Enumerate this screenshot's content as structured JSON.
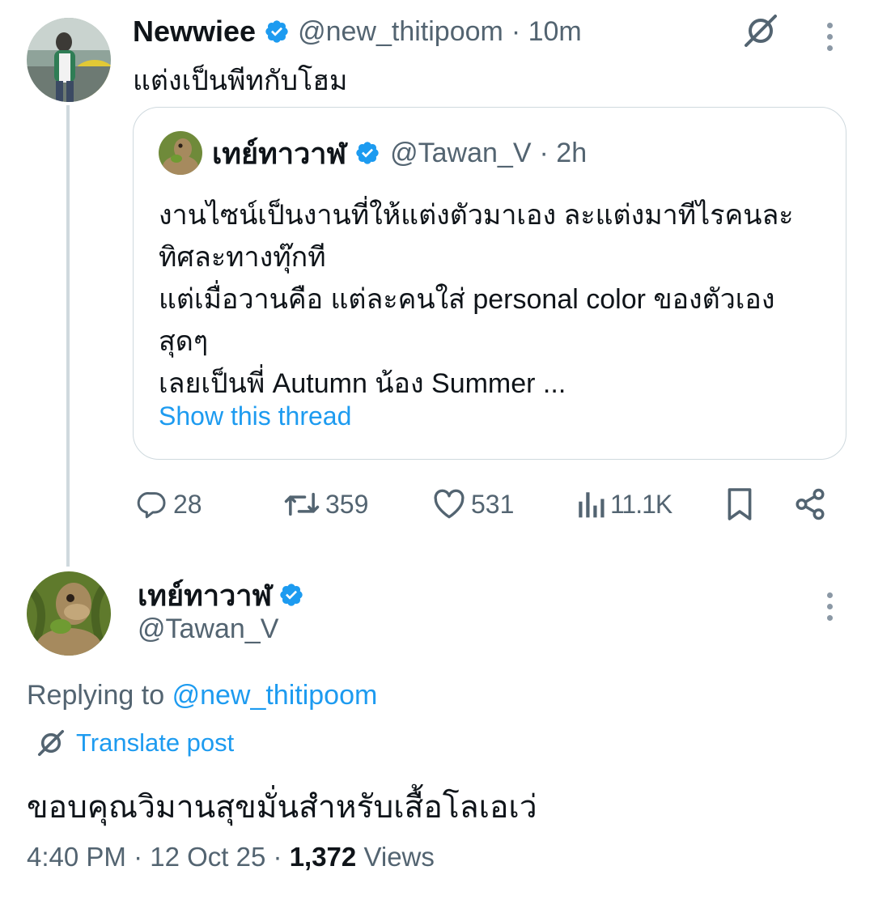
{
  "top_post": {
    "author_name": "Newwiee",
    "handle": "@new_thitipoom",
    "time": "· 10m",
    "text": "แต่งเป็นพีทกับโฮม"
  },
  "quoted_post": {
    "author_name": "เทย์ทาวาฬ",
    "handle": "@Tawan_V",
    "time": "· 2h",
    "lines": [
      "งานไซน์เป็นงานที่ให้แต่งตัวมาเอง ละแต่งมาทีไรคนละ",
      "ทิศละทางทุ๊กที",
      "แต่เมื่อวานคือ แต่ละคนใส่ personal color ของตัวเอง",
      "สุดๆ",
      "เลยเป็นพี่ Autumn น้อง Summer ..."
    ],
    "show_thread": "Show this thread"
  },
  "actions": {
    "replies": "28",
    "reposts": "359",
    "likes": "531",
    "views": "11.1K"
  },
  "main_post": {
    "author_name": "เทย์ทาวาฬ",
    "handle": "@Tawan_V",
    "replying_prefix": "Replying to",
    "replying_handle": "@new_thitipoom",
    "translate": "Translate post",
    "text": "ขอบคุณวิมานสุขมั่นสำหรับเสื้อโลเอเว่",
    "time": "4:40 PM",
    "date": "12 Oct 25",
    "views_count": "1,372",
    "views_label": "Views",
    "separator": "·"
  },
  "colors": {
    "link": "#1d9bf0",
    "muted": "#536471",
    "verified": "#1d9bf0",
    "divider": "#cfd9de"
  },
  "icons": [
    "verified-badge-icon",
    "translate-icon",
    "more-icon",
    "reply-icon",
    "repost-icon",
    "like-icon",
    "views-icon",
    "bookmark-icon",
    "share-icon"
  ]
}
